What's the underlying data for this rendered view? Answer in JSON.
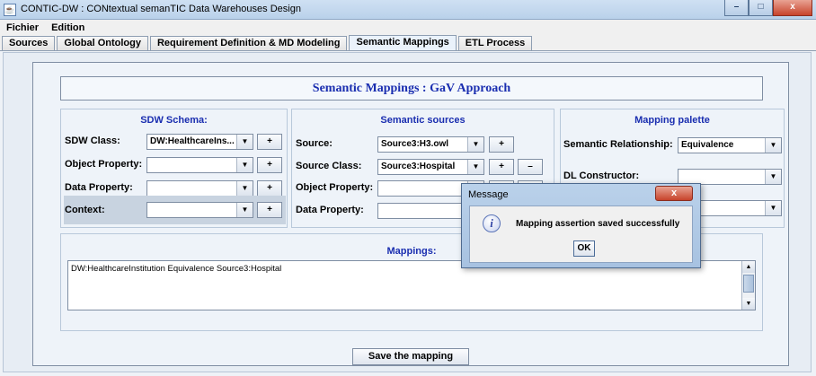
{
  "window": {
    "title": "CONTIC-DW : CONtextual semanTIC Data Warehouses Design",
    "app_icon": "java-icon",
    "controls": {
      "minimize": "–",
      "maximize": "□",
      "close": "x"
    }
  },
  "menubar": {
    "items": [
      "Fichier",
      "Edition"
    ]
  },
  "tabs": [
    {
      "label": "Sources",
      "active": false
    },
    {
      "label": "Global Ontology",
      "active": false
    },
    {
      "label": "Requirement Definition & MD Modeling",
      "active": false
    },
    {
      "label": "Semantic Mappings",
      "active": true
    },
    {
      "label": "ETL Process",
      "active": false
    }
  ],
  "header": {
    "title": "Semantic Mappings : GaV Approach"
  },
  "sdw_schema": {
    "title": "SDW Schema:",
    "class_label": "SDW Class:",
    "class_value": "DW:HealthcareIns...",
    "object_property_label": "Object Property:",
    "object_property_value": "",
    "data_property_label": "Data Property:",
    "data_property_value": "",
    "context_label": "Context:",
    "context_value": "",
    "add_label": "+"
  },
  "semantic_sources": {
    "title": "Semantic sources",
    "source_label": "Source:",
    "source_value": "Source3:H3.owl",
    "class_label": "Source Class:",
    "class_value": "Source3:Hospital",
    "object_property_label": "Object Property:",
    "object_property_value": "",
    "data_property_label": "Data Property:",
    "data_property_value": "",
    "add_label": "+",
    "remove_label": "–"
  },
  "mapping_palette": {
    "title": "Mapping palette",
    "relationship_label": "Semantic Relationship:",
    "relationship_value": "Equivalence",
    "dl_constructor_label": "DL Constructor:",
    "dl_constructor_value": "",
    "extra_value": ""
  },
  "mappings": {
    "title": "Mappings:",
    "lines": [
      "DW:HealthcareInstitution  Equivalence  Source3:Hospital"
    ]
  },
  "save_button": {
    "label": "Save the mapping"
  },
  "dialog": {
    "title": "Message",
    "close": "x",
    "icon": "info-icon",
    "message": "Mapping assertion saved successfully",
    "ok_label": "OK"
  }
}
